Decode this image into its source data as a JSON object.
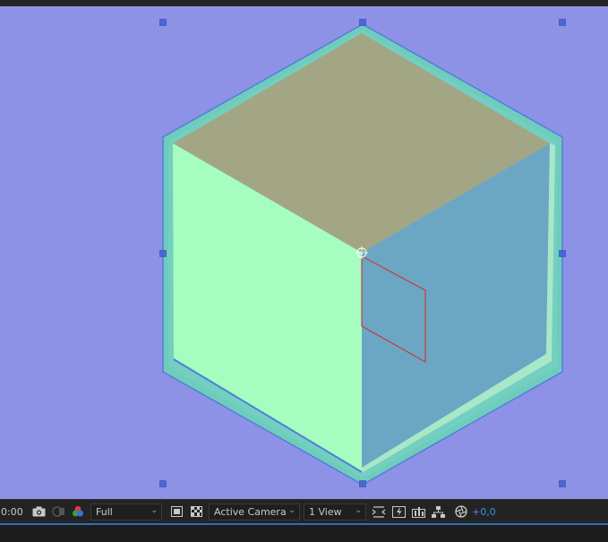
{
  "toolbar": {
    "timecode": "0:00",
    "resolution": "Full",
    "camera": "Active Camera",
    "views": "1 View",
    "exposure": "+0,0"
  },
  "colors": {
    "viewport_bg": "#8e92e6",
    "cube_top": "#a3a684",
    "cube_left": "#a5fdc0",
    "cube_right": "#6ba7c4",
    "bevel": "#6fccbd",
    "selection_handle": "#4a66d8",
    "red_outline": "#c83a3a",
    "accent_blue": "#3d8ee8"
  },
  "icons": [
    "camera-icon",
    "show-snapshot-icon",
    "color-channels-icon",
    "region-of-interest-icon",
    "transparency-grid-icon",
    "fast-previews-icon",
    "timeline-icon",
    "comp-flowchart-icon",
    "reset-exposure-icon"
  ]
}
